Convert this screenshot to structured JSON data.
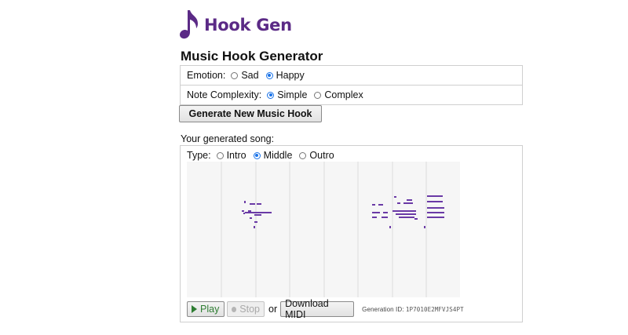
{
  "brand": {
    "name": "Hook Gen",
    "logo_icon": "music-note-icon",
    "color": "#5b2a86"
  },
  "page": {
    "title": "Music Hook Generator"
  },
  "options": {
    "emotion": {
      "label": "Emotion:",
      "choices": [
        "Sad",
        "Happy"
      ],
      "selected": "Happy"
    },
    "complexity": {
      "label": "Note Complexity:",
      "choices": [
        "Simple",
        "Complex"
      ],
      "selected": "Simple"
    }
  },
  "generate_button": "Generate New Music Hook",
  "song": {
    "label": "Your generated song:",
    "type": {
      "label": "Type:",
      "choices": [
        "Intro",
        "Middle",
        "Outro"
      ],
      "selected": "Middle"
    },
    "piano_roll": {
      "note_color": "#6a3aa6",
      "grid_color": "#dcdcdc",
      "background": "#f6f6f6"
    }
  },
  "controls": {
    "play_label": "Play",
    "stop_label": "Stop",
    "or_text": "or",
    "download_label": "Download MIDI",
    "generation_id_label": "Generation ID:",
    "generation_id": "1P7010E2MFVJS4PT",
    "play_color": "#2e7d32"
  }
}
